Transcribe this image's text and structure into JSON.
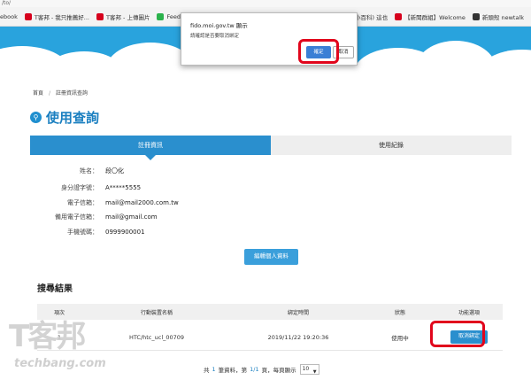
{
  "browser": {
    "url_fragment": "/to/",
    "bookmarks": [
      {
        "label": "ebook",
        "color": "#3b5998"
      },
      {
        "label": "T客邦 - 我只推薦好...",
        "color": "#d6001c"
      },
      {
        "label": "T客邦 - 上傳圖片",
        "color": "#d6001c"
      },
      {
        "label": "Feedly",
        "color": "#2bb24c"
      },
      {
        "label": "A",
        "color": "#4a7bd1"
      }
    ],
    "right_bookmarks": [
      {
        "label": "...與小百科) 這也",
        "color": "#f2a600"
      },
      {
        "label": "【新聞群組】Welcome",
        "color": "#d6001c"
      },
      {
        "label": "新頭殼 newtalk",
        "color": "#333333"
      }
    ]
  },
  "dialog": {
    "title": "fido.moi.gov.tw 顯示",
    "message": "請確認是否要取消綁定",
    "ok_label": "確定",
    "cancel_label": "取消"
  },
  "breadcrumb": {
    "home": "首頁",
    "current": "註冊資訊查詢"
  },
  "page": {
    "title": "使用查詢"
  },
  "tabs": [
    {
      "label": "註冊資訊",
      "active": true
    },
    {
      "label": "使用紀錄",
      "active": false
    }
  ],
  "info": [
    {
      "label": "姓名：",
      "value": "段〇化"
    },
    {
      "label": "身分證字號：",
      "value": "A*****5555"
    },
    {
      "label": "電子信箱：",
      "value": "mail@mail2000.com.tw"
    },
    {
      "label": "備用電子信箱：",
      "value": "mail@gmail.com"
    },
    {
      "label": "手機號碼：",
      "value": "0999900001"
    }
  ],
  "edit_button": "編輯個人資料",
  "results": {
    "title": "搜尋結果",
    "columns": [
      "項次",
      "行動裝置名稱",
      "綁定時間",
      "狀態",
      "功能選項"
    ],
    "rows": [
      {
        "index": "1",
        "device": "HTC/htc_ucl_00709",
        "bound_at": "2019/11/22 19:20:36",
        "status": "使用中",
        "action": "取消綁定"
      }
    ]
  },
  "pager": {
    "prefix": "共",
    "total_records": "1",
    "records_label": "筆資料，第",
    "current_page": "1/1",
    "page_label": "頁，每頁顯示",
    "per_page": "10"
  },
  "watermark": {
    "logo": "T客邦",
    "site": "techbang.com"
  },
  "colors": {
    "brand_blue": "#2a8fce",
    "header_blue": "#29a3dd",
    "highlight_red": "#e1061c"
  }
}
